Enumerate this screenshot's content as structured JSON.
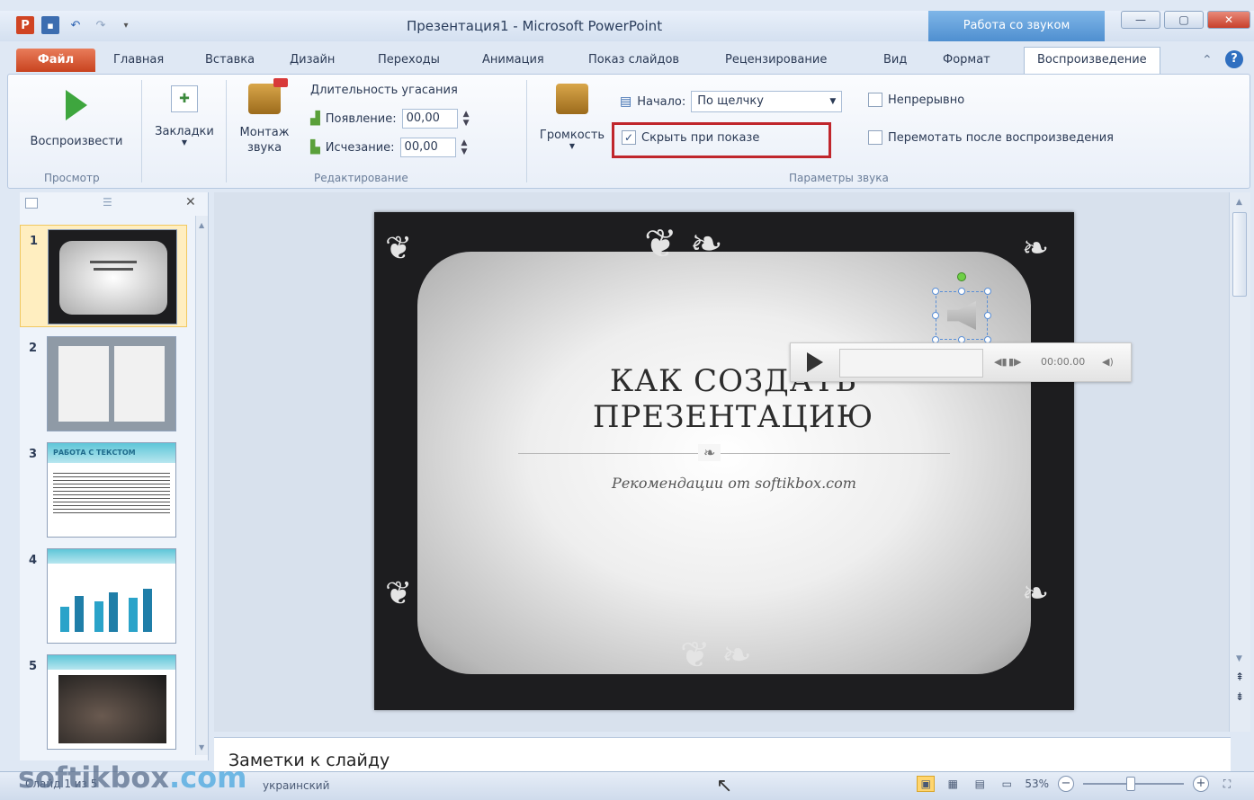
{
  "window": {
    "title": "Презентация1  -  Microsoft PowerPoint",
    "context_tab_title": "Работа со звуком",
    "controls": [
      "—",
      "▢",
      "✕"
    ]
  },
  "quick_access": {
    "icons": [
      "powerpoint-logo",
      "save-icon",
      "undo-icon",
      "redo-icon",
      "customize-icon"
    ]
  },
  "tabs": [
    {
      "label": "Файл"
    },
    {
      "label": "Главная"
    },
    {
      "label": "Вставка"
    },
    {
      "label": "Дизайн"
    },
    {
      "label": "Переходы"
    },
    {
      "label": "Анимация"
    },
    {
      "label": "Показ слайдов"
    },
    {
      "label": "Рецензирование"
    },
    {
      "label": "Вид"
    },
    {
      "label": "Формат"
    },
    {
      "label": "Воспроизведение"
    }
  ],
  "ribbon": {
    "preview": {
      "play_label": "Воспроизвести",
      "group_label": "Просмотр"
    },
    "bookmarks": {
      "label": "Закладки"
    },
    "editing": {
      "trim_label": "Монтаж звука",
      "fade_title": "Длительность угасания",
      "fade_in_label": "Появление:",
      "fade_in_value": "00,00",
      "fade_out_label": "Исчезание:",
      "fade_out_value": "00,00",
      "group_label": "Редактирование"
    },
    "audio_options": {
      "volume_label": "Громкость",
      "start_label": "Начало:",
      "start_value": "По щелчку",
      "loop_label": "Непрерывно",
      "hide_label": "Скрыть при показе",
      "hide_checked": true,
      "rewind_label": "Перемотать после воспроизведения",
      "group_label": "Параметры звука"
    }
  },
  "slides": [
    {
      "number": "1"
    },
    {
      "number": "2"
    },
    {
      "number": "3",
      "title": "РАБОТА С ТЕКСТОМ"
    },
    {
      "number": "4"
    },
    {
      "number": "5"
    }
  ],
  "slide": {
    "title_line1": "КАК СОЗДАТЬ",
    "title_line2": "ПРЕЗЕНТАЦИЮ",
    "subtitle": "Рекомендации от softikbox.com",
    "divider_ornament": "❧"
  },
  "player": {
    "time": "00:00.00",
    "icons": [
      "play-icon",
      "back-icon",
      "forward-icon",
      "volume-icon"
    ]
  },
  "notes": {
    "placeholder": "Заметки к слайду"
  },
  "statusbar": {
    "slide_info": "Слайд 1 из 5",
    "language": "украинский",
    "zoom": "53%",
    "zoom_fraction": 0.43
  },
  "watermark": {
    "text_main": "softikbox",
    "text_accent": ".com"
  }
}
